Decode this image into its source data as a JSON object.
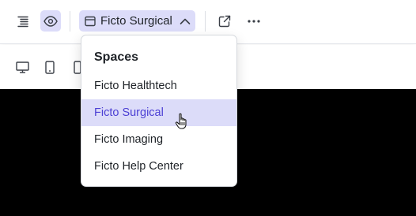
{
  "toolbar": {
    "space_selector": {
      "label": "Ficto Surgical",
      "expanded": true
    },
    "icons": [
      "outline-icon",
      "preview-eye-icon",
      "window-icon",
      "chevron-up-icon",
      "open-external-icon",
      "more-icon"
    ]
  },
  "device_bar": {
    "icons": [
      "desktop-icon",
      "tablet-icon",
      "mobile-icon"
    ]
  },
  "dropdown": {
    "title": "Spaces",
    "items": [
      {
        "label": "Ficto Healthtech",
        "selected": false
      },
      {
        "label": "Ficto Surgical",
        "selected": true
      },
      {
        "label": "Ficto Imaging",
        "selected": false
      },
      {
        "label": "Ficto Help Center",
        "selected": false
      }
    ]
  },
  "colors": {
    "accent_bg": "#dcdcf9",
    "accent_text": "#4b3fd4",
    "preview_bg": "#000000"
  }
}
